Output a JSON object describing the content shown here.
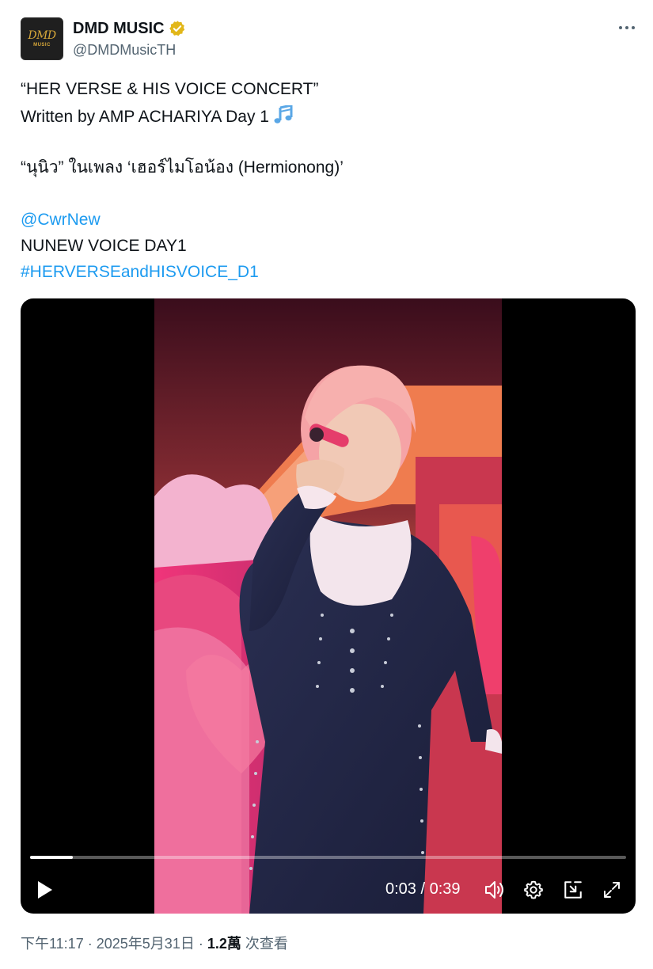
{
  "header": {
    "avatar_logo": "DMD",
    "avatar_logo_sub": "MUSIC",
    "display_name": "DMD MUSIC",
    "handle": "@DMDMusicTH",
    "verified_color": "#e2b719",
    "more_icon": "more-horizontal-icon"
  },
  "post": {
    "line1": "“HER VERSE & HIS VOICE CONCERT”",
    "line2": "Written by AMP ACHARIYA Day 1",
    "line2_icon": "musical-notes-icon",
    "line3": "“นุนิว” ในเพลง ‘เฮอร์ไมโอน้อง (Hermionong)’",
    "mention": "@CwrNew",
    "line5": "NUNEW VOICE DAY1",
    "hashtag": "#HERVERSEandHISVOICE_D1",
    "link_color": "#1d9bf0"
  },
  "video": {
    "current_time": "0:03",
    "separator": "/",
    "duration": "0:39",
    "progress_fraction": 0.072,
    "controls": [
      "play-icon",
      "volume-icon",
      "settings-gear-icon",
      "pop-out-icon",
      "fullscreen-icon"
    ]
  },
  "footer": {
    "time": "下午11:17",
    "dot1": "·",
    "date": "2025年5月31日",
    "dot2": "·",
    "views_count": "1.2萬",
    "views_label": "次查看"
  }
}
